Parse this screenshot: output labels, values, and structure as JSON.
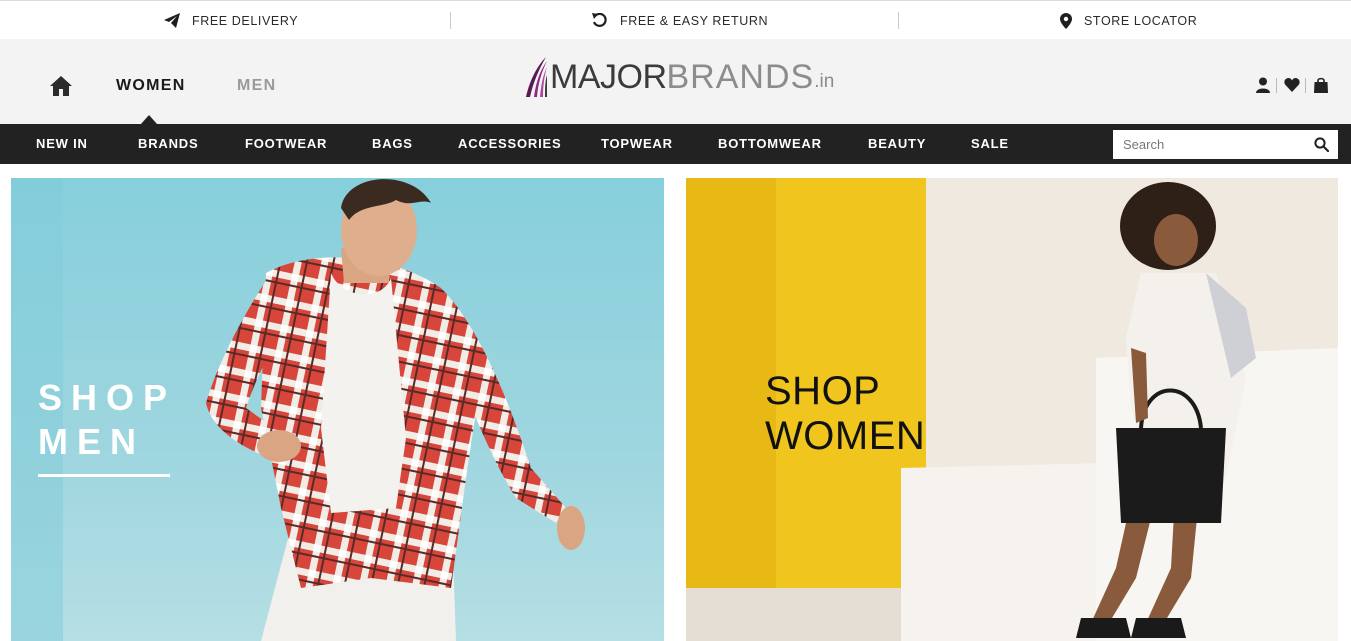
{
  "topbar": {
    "free_delivery": "FREE DELIVERY",
    "free_return": "FREE & EASY RETURN",
    "store_locator": "STORE LOCATOR"
  },
  "header": {
    "tabs": {
      "women": "WOMEN",
      "men": "MEN"
    },
    "active_tab": "WOMEN",
    "logo": {
      "major": "MAJOR",
      "brands": "BRANDS",
      "tld": ".in"
    }
  },
  "nav": {
    "items": [
      "NEW IN",
      "BRANDS",
      "FOOTWEAR",
      "BAGS",
      "ACCESSORIES",
      "TOPWEAR",
      "BOTTOMWEAR",
      "BEAUTY",
      "SALE"
    ],
    "search_placeholder": "Search"
  },
  "banners": {
    "men": {
      "line1": "SHOP",
      "line2": "MEN"
    },
    "women": {
      "line1": "SHOP",
      "line2": "WOMEN"
    }
  },
  "icons": {
    "topbar": [
      "paper-plane-icon",
      "return-arrow-icon",
      "map-pin-icon"
    ],
    "header": [
      "home-icon",
      "user-icon",
      "heart-icon",
      "shopping-bag-icon"
    ],
    "search": "search-icon"
  },
  "colors": {
    "navbar_bg": "#222222",
    "header_bg": "#f3f3f3",
    "logo_accent": "#7b1e6e",
    "men_banner_bg": "#8fd2dd",
    "women_banner_yellow": "#f0c61e"
  }
}
